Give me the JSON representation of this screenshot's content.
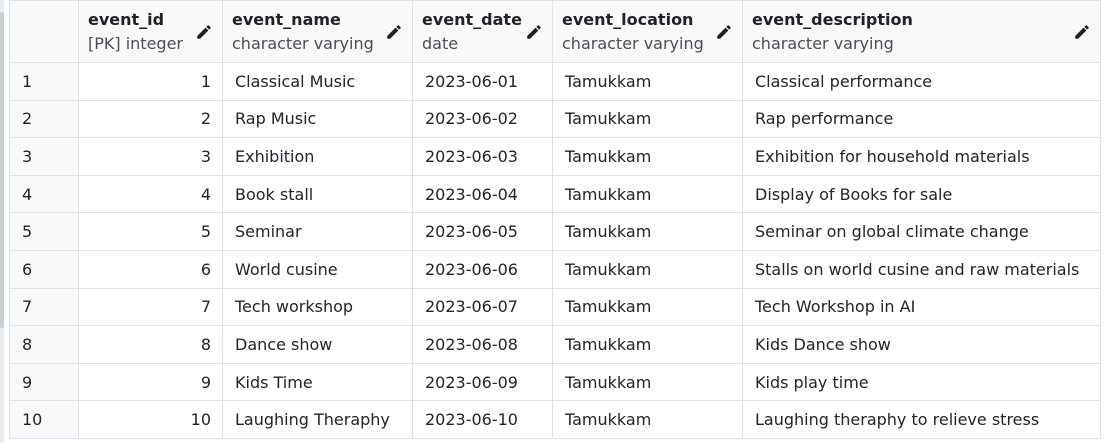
{
  "columns": [
    {
      "name": "event_id",
      "type": "[PK] integer"
    },
    {
      "name": "event_name",
      "type": "character varying"
    },
    {
      "name": "event_date",
      "type": "date"
    },
    {
      "name": "event_location",
      "type": "character varying"
    },
    {
      "name": "event_description",
      "type": "character varying"
    }
  ],
  "rows": [
    {
      "n": "1",
      "event_id": "1",
      "event_name": "Classical Music",
      "event_date": "2023-06-01",
      "event_location": "Tamukkam",
      "event_description": "Classical performance"
    },
    {
      "n": "2",
      "event_id": "2",
      "event_name": "Rap Music",
      "event_date": "2023-06-02",
      "event_location": "Tamukkam",
      "event_description": "Rap performance"
    },
    {
      "n": "3",
      "event_id": "3",
      "event_name": "Exhibition",
      "event_date": "2023-06-03",
      "event_location": "Tamukkam",
      "event_description": "Exhibition for household materials"
    },
    {
      "n": "4",
      "event_id": "4",
      "event_name": "Book stall",
      "event_date": "2023-06-04",
      "event_location": "Tamukkam",
      "event_description": "Display of Books for sale"
    },
    {
      "n": "5",
      "event_id": "5",
      "event_name": "Seminar",
      "event_date": "2023-06-05",
      "event_location": "Tamukkam",
      "event_description": "Seminar on global climate change"
    },
    {
      "n": "6",
      "event_id": "6",
      "event_name": "World cusine",
      "event_date": "2023-06-06",
      "event_location": "Tamukkam",
      "event_description": "Stalls on world cusine and raw materials"
    },
    {
      "n": "7",
      "event_id": "7",
      "event_name": "Tech workshop",
      "event_date": "2023-06-07",
      "event_location": "Tamukkam",
      "event_description": "Tech Workshop in AI"
    },
    {
      "n": "8",
      "event_id": "8",
      "event_name": "Dance show",
      "event_date": "2023-06-08",
      "event_location": "Tamukkam",
      "event_description": "Kids Dance show"
    },
    {
      "n": "9",
      "event_id": "9",
      "event_name": "Kids Time",
      "event_date": "2023-06-09",
      "event_location": "Tamukkam",
      "event_description": "Kids play time"
    },
    {
      "n": "10",
      "event_id": "10",
      "event_name": "Laughing Theraphy",
      "event_date": "2023-06-10",
      "event_location": "Tamukkam",
      "event_description": "Laughing theraphy to relieve stress"
    }
  ],
  "icons": {
    "edit": "pencil-icon"
  },
  "colors": {
    "header_bg": "#f8f9fa",
    "grid_line": "#dee2e6",
    "text": "#212529"
  }
}
